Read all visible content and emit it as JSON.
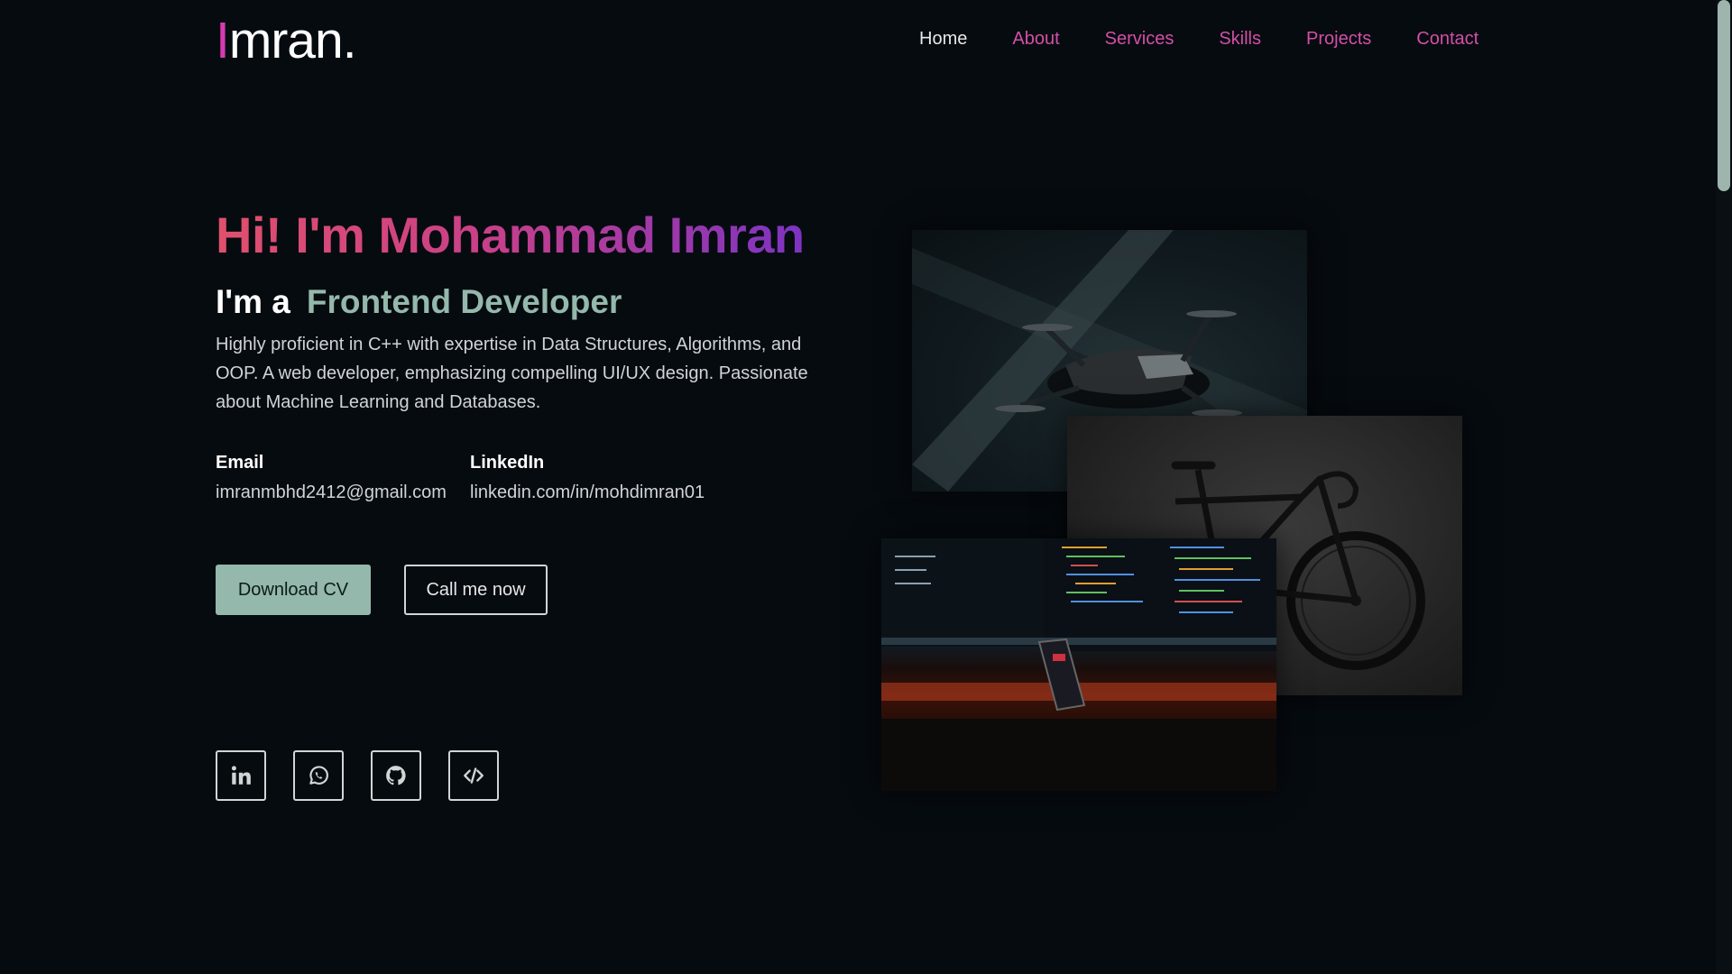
{
  "header": {
    "logo_initial": "I",
    "logo_rest": "mran.",
    "nav": [
      {
        "label": "Home"
      },
      {
        "label": "About"
      },
      {
        "label": "Services"
      },
      {
        "label": "Skills"
      },
      {
        "label": "Projects"
      },
      {
        "label": "Contact"
      }
    ],
    "active_nav": "Home"
  },
  "hero": {
    "title": "Hi! I'm Mohammad Imran",
    "role_prefix": "I'm a",
    "role_value": "Frontend Developer",
    "description": "Highly proficient in C++ with expertise in Data Structures, Algorithms, and OOP. A web developer, emphasizing compelling UI/UX design. Passionate about Machine Learning and Databases.",
    "email_label": "Email",
    "email_value": "imranmbhd2412@gmail.com",
    "linkedin_label": "LinkedIn",
    "linkedin_value": "linkedin.com/in/mohdimran01",
    "download_cv_label": "Download CV",
    "call_label": "Call me now"
  },
  "social": [
    {
      "icon": "linkedin-icon"
    },
    {
      "icon": "whatsapp-icon"
    },
    {
      "icon": "github-icon"
    },
    {
      "icon": "code-icon"
    }
  ],
  "colors": {
    "background": "#060b10",
    "accent_pink": "#d34fa6",
    "accent_mint": "#94b8ab",
    "gradient_start": "#e0506c",
    "gradient_end": "#7d33c2"
  }
}
